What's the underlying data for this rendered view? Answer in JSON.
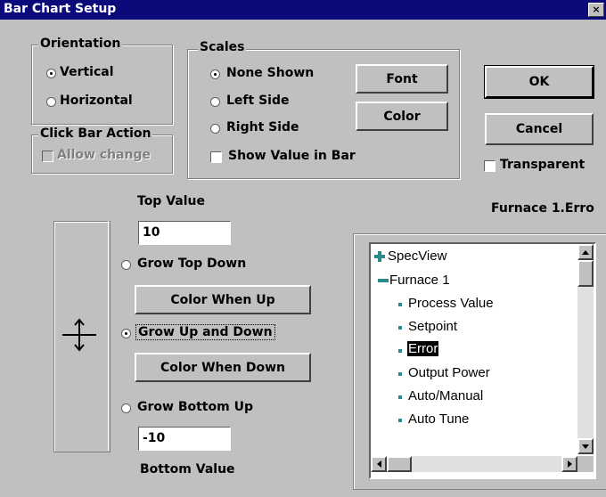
{
  "window": {
    "title": "Bar Chart Setup",
    "close_glyph": "×"
  },
  "orientation": {
    "legend": "Orientation",
    "vertical": "Vertical",
    "horizontal": "Horizontal",
    "selected": "Vertical"
  },
  "click_bar_action": {
    "legend": "Click Bar Action",
    "allow_change": "Allow change",
    "allow_change_enabled": false
  },
  "scales": {
    "legend": "Scales",
    "none_shown": "None Shown",
    "left_side": "Left Side",
    "right_side": "Right Side",
    "show_value": "Show Value in Bar",
    "selected": "None Shown"
  },
  "buttons": {
    "font": "Font",
    "color": "Color",
    "ok": "OK",
    "cancel": "Cancel",
    "color_when_up": "Color When Up",
    "color_when_down": "Color When Down"
  },
  "transparent": "Transparent",
  "bar_label": "Furnace 1.Erro",
  "top_value": {
    "label": "Top Value",
    "value": "10"
  },
  "bottom_value": {
    "label": "Bottom Value",
    "value": "-10"
  },
  "grow": {
    "top_down": "Grow Top Down",
    "up_and_down": "Grow Up and Down",
    "bottom_up": "Grow Bottom Up",
    "selected": "Grow Up and Down"
  },
  "tree": {
    "root": "SpecView",
    "group": "Furnace 1",
    "items": [
      "Process Value",
      "Setpoint",
      "Error",
      "Output Power",
      "Auto/Manual",
      "Auto Tune"
    ],
    "selected": "Error"
  },
  "colors": {
    "title_bar": "#0a0a7a",
    "tree_icon": "#2a8a8a",
    "face": "#c0c0c0"
  },
  "icons": [
    "close-icon",
    "move-arrows-icon",
    "plus-icon",
    "minus-icon",
    "scroll-up-icon",
    "scroll-down-icon",
    "scroll-left-icon",
    "scroll-right-icon"
  ]
}
